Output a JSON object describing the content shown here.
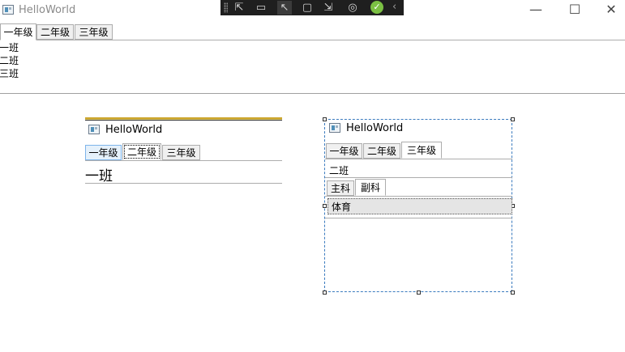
{
  "window": {
    "title": "HelloWorld",
    "controls": {
      "minimize": "—",
      "maximize": "☐",
      "close": "✕"
    }
  },
  "debug_toolbar": {
    "buttons": [
      {
        "name": "select-element-icon",
        "glyph": "⇱"
      },
      {
        "name": "video-icon",
        "glyph": "▭"
      },
      {
        "name": "pointer-icon",
        "glyph": "↖"
      },
      {
        "name": "layout-adorner-icon",
        "glyph": "▢"
      },
      {
        "name": "track-focus-icon",
        "glyph": "⇲"
      },
      {
        "name": "hot-reload-icon",
        "glyph": "◎"
      }
    ],
    "status_glyph": "✓",
    "collapse_glyph": "‹"
  },
  "main": {
    "tabs": [
      "一年级",
      "二年级",
      "三年级"
    ],
    "selected_tab": 0,
    "classes": [
      "一班",
      "二班",
      "三班"
    ]
  },
  "preview_left": {
    "title": "HelloWorld",
    "tabs": [
      "一年级",
      "二年级",
      "三年级"
    ],
    "focused_tab": 1,
    "content": "一班"
  },
  "preview_right": {
    "title": "HelloWorld",
    "tabs": [
      "一年级",
      "二年级",
      "三年级"
    ],
    "selected_tab": 2,
    "class_label": "二班",
    "subject_tabs": [
      "主科",
      "副科"
    ],
    "selected_subject_tab": 1,
    "subject_content": "体育"
  }
}
